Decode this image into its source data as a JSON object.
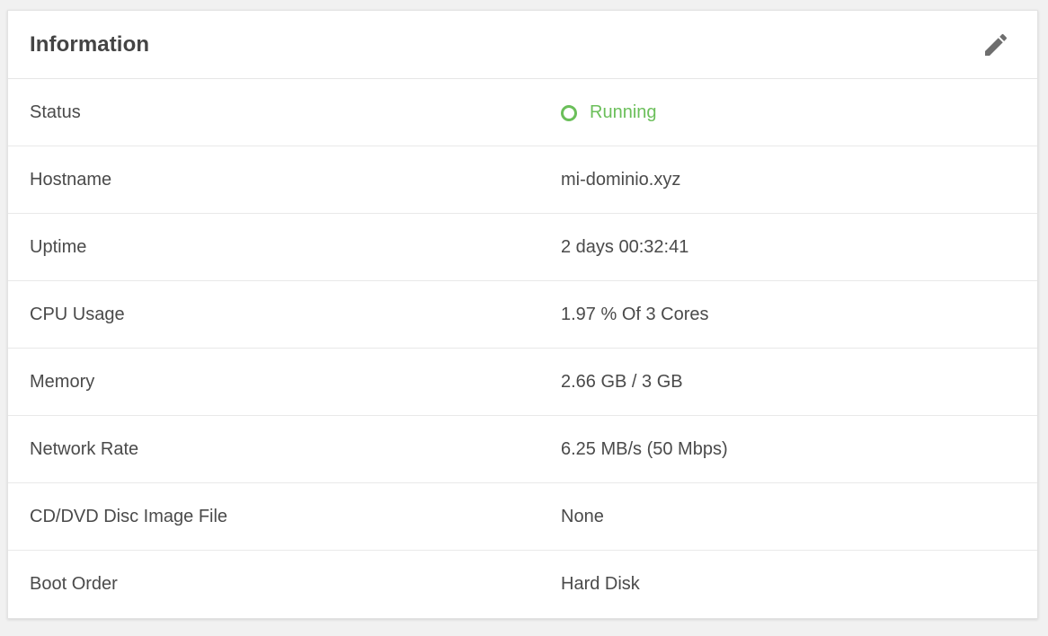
{
  "card": {
    "title": "Information",
    "edit_icon": "pencil-icon"
  },
  "colors": {
    "status_running": "#6bbf5a",
    "text": "#4a4a4a"
  },
  "rows": [
    {
      "label": "Status",
      "value": "Running",
      "type": "status",
      "icon": "status-circle-icon"
    },
    {
      "label": "Hostname",
      "value": "mi-dominio.xyz"
    },
    {
      "label": "Uptime",
      "value": "2 days 00:32:41"
    },
    {
      "label": "CPU Usage",
      "value": "1.97 % Of 3 Cores"
    },
    {
      "label": "Memory",
      "value": "2.66 GB / 3 GB"
    },
    {
      "label": "Network Rate",
      "value": "6.25 MB/s (50 Mbps)"
    },
    {
      "label": "CD/DVD Disc Image File",
      "value": "None"
    },
    {
      "label": "Boot Order",
      "value": "Hard Disk"
    }
  ]
}
